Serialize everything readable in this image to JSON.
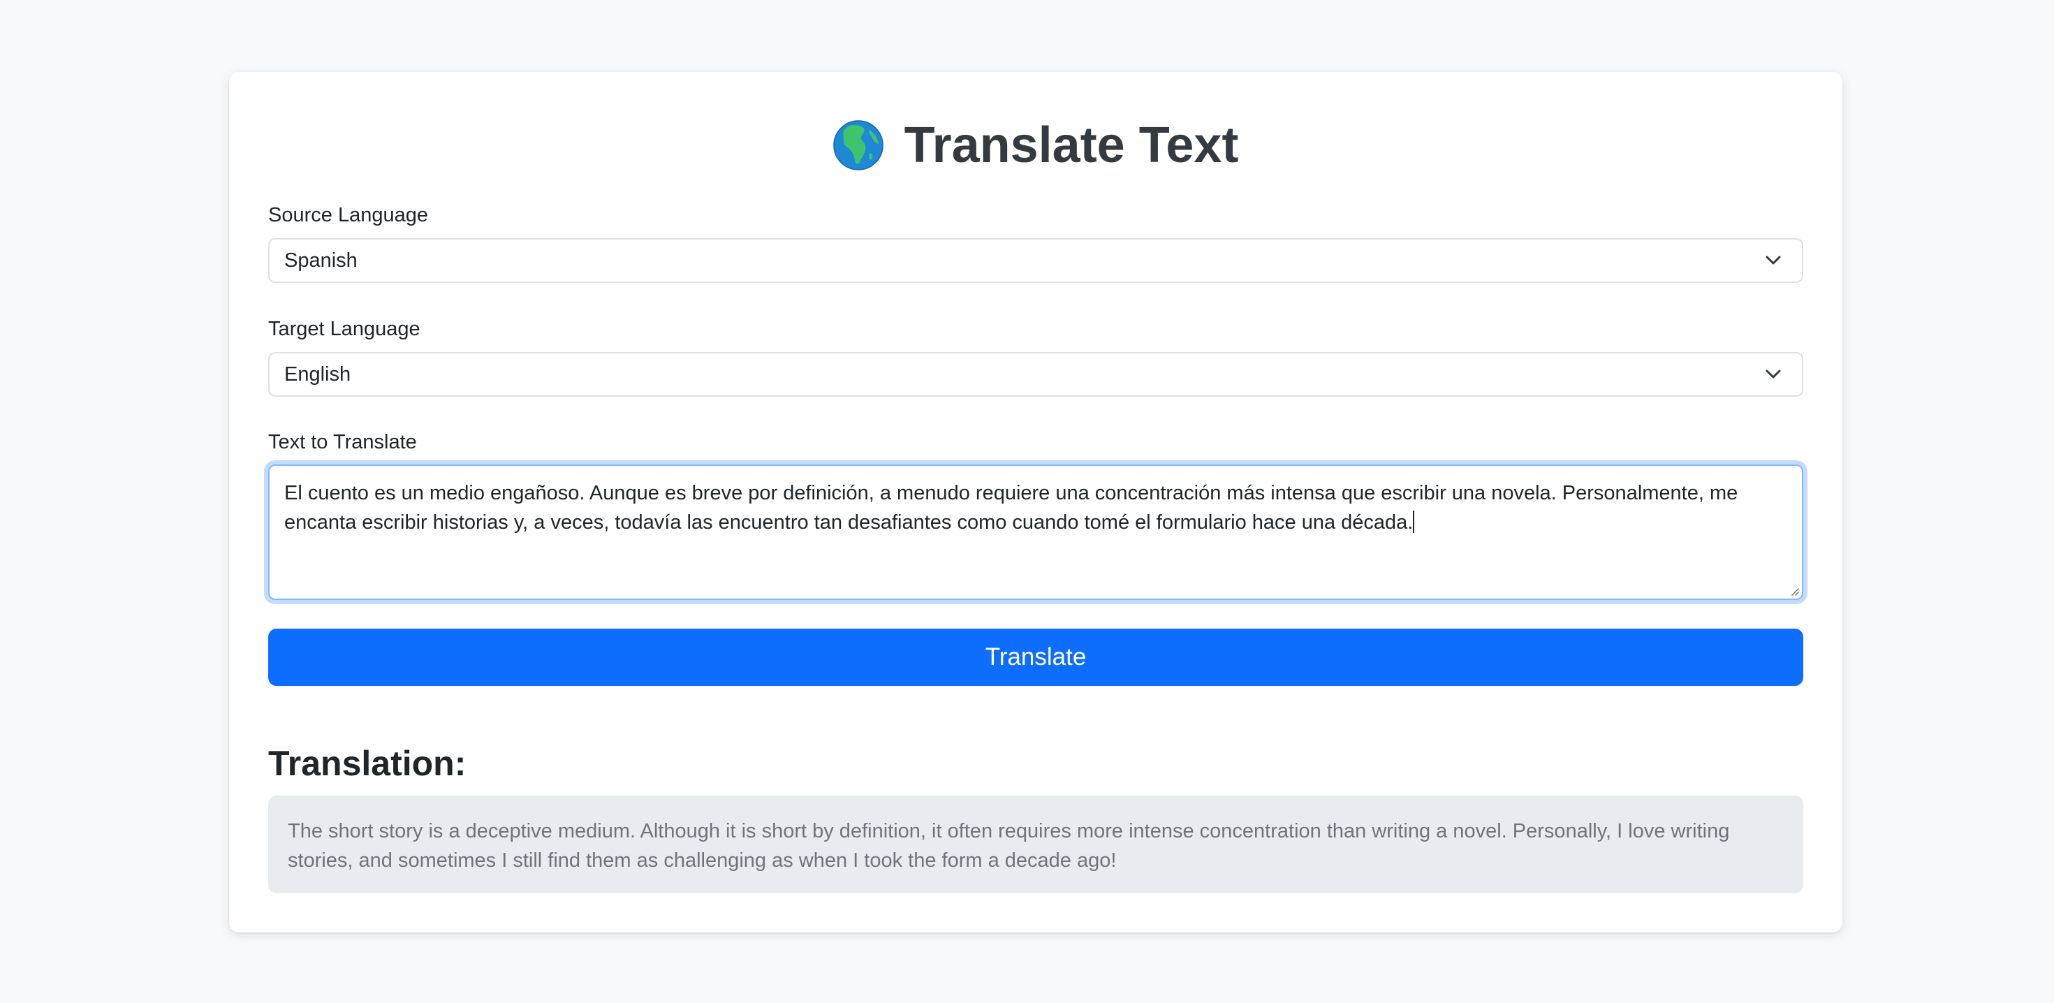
{
  "header": {
    "title": "Translate Text"
  },
  "form": {
    "source_label": "Source Language",
    "source_value": "Spanish",
    "target_label": "Target Language",
    "target_value": "English",
    "text_label": "Text to Translate",
    "text_value": "El cuento es un medio engañoso. Aunque es breve por definición, a menudo requiere una concentración más intensa que escribir una novela. Personalmente, me encanta escribir historias y, a veces, todavía las encuentro tan desafiantes como cuando tomé el formulario hace una década.",
    "translate_button": "Translate"
  },
  "result": {
    "heading": "Translation:",
    "text": "The short story is a deceptive medium. Although it is short by definition, it often requires more intense concentration than writing a novel. Personally, I love writing stories, and sometimes I still find them as challenging as when I took the form a decade ago!"
  },
  "icons": {
    "title_icon": "globe-africa-icon",
    "select_icon": "chevron-down-icon",
    "resize_icon": "resize-handle-icon"
  },
  "colors": {
    "background": "#f8f9fa",
    "primary": "#0d6efd",
    "focus_border": "#86b7fe",
    "result_background": "#e9ecef",
    "muted_text": "#6c757d"
  }
}
